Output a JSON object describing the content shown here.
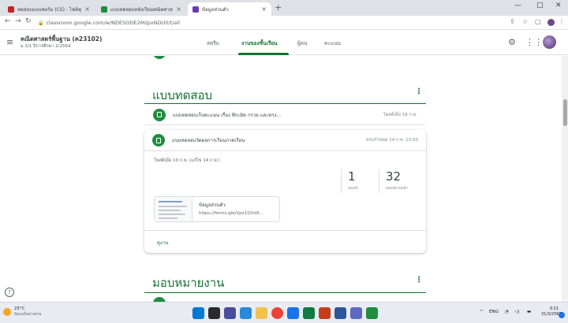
{
  "browser": {
    "tabs": [
      {
        "title": "ทดสอบแบบฟอร์ม (CS) - ไฟล์ทุกอย่าง",
        "favicon_color": "#c5221f",
        "active": false
      },
      {
        "title": "แบบทดสอบหลังเรียนคณิตศาสตร์ คณิตฯ",
        "favicon_color": "#1e8e3e",
        "active": false
      },
      {
        "title": "ข้อมูลส่วนตัว",
        "favicon_color": "#673ab7",
        "active": true
      }
    ],
    "new_tab": "+",
    "tab_close": "×",
    "url": "classroom.google.com/w/NDESODE2MzpxNDU0/t/all",
    "controls": {
      "minimize": "—",
      "maximize": "□",
      "close": "✕"
    }
  },
  "classroom": {
    "course_title": "คณิตศาสตร์พื้นฐาน (ค23102)",
    "course_subtitle": "ม.3/1 ปีการศึกษา 2/2564",
    "tabs": [
      {
        "label": "สตรีม",
        "active": false
      },
      {
        "label": "งานของชั้นเรียน",
        "active": true
      },
      {
        "label": "ผู้คน",
        "active": false
      },
      {
        "label": "คะแนน",
        "active": false
      }
    ]
  },
  "sections": [
    {
      "title": "แบบทดสอบ",
      "menu": "⋮",
      "items": [
        {
          "title": "แบบทดสอบเก็บคะแนน เรื่อง พีระมิด กรวย และทรง...",
          "meta": "โพสต์เมื่อ 18 ก.พ."
        },
        {
          "title": "แบบทดสอบวัดผลการเรียนภาคเรียน",
          "meta": "ครบกำหนด 14 ก.พ. 13:00"
        }
      ],
      "expanded": {
        "due_text": "โพสต์เมื่อ 10 ก.พ. (แก้ไข 14 ก.พ.)",
        "stats": [
          {
            "number": "1",
            "label": "ส่งแล้ว"
          },
          {
            "number": "32",
            "label": "มอบหมายแล้ว"
          }
        ],
        "attachment": {
          "title": "ข้อมูลส่วนตัว",
          "url": "https://forms.gle/Vpx1QVdX..."
        },
        "view_link": "ดูงาน"
      }
    },
    {
      "title": "มอบหมายงาน",
      "menu": "⋮"
    }
  ],
  "taskbar": {
    "temperature": "25°C",
    "weather": "มีเมฆเป็นบางส่วน",
    "tray_lang": "ENG",
    "time": "9:21",
    "date": "31/3/2565"
  }
}
